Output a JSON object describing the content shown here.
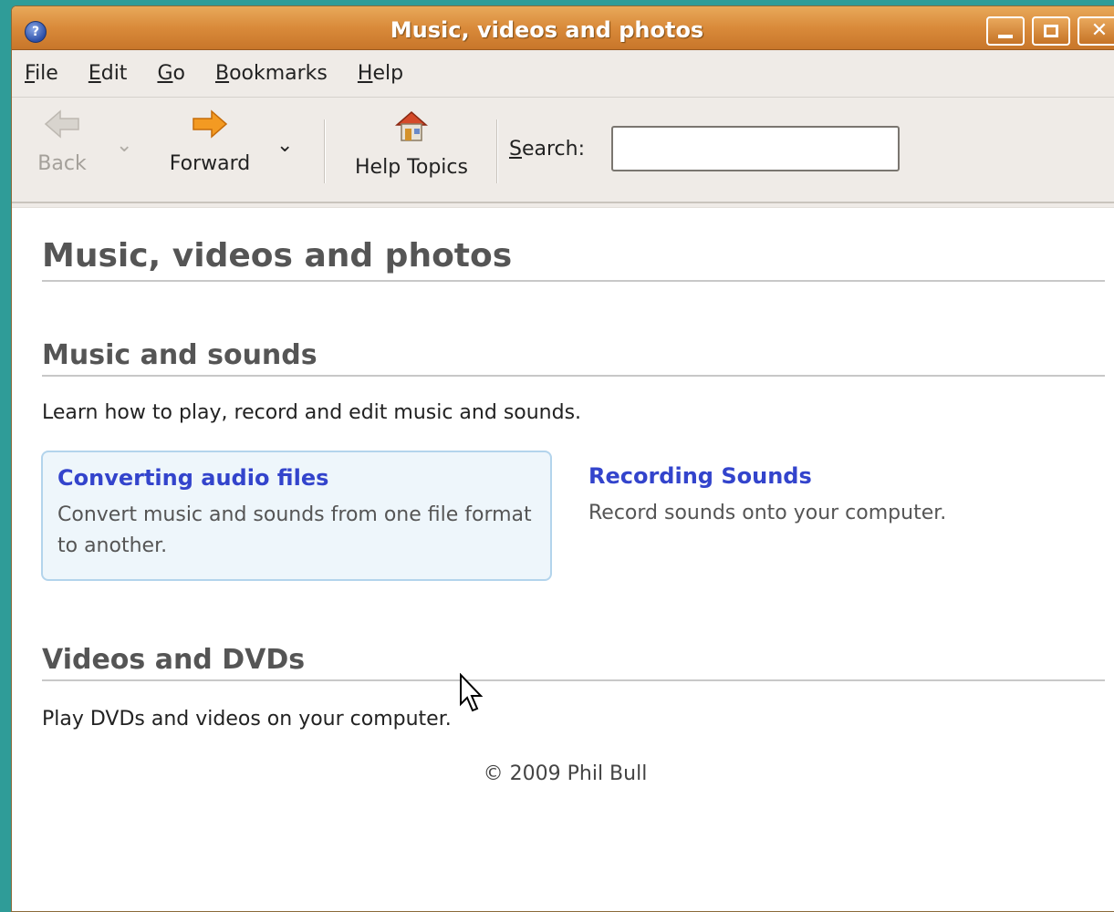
{
  "window": {
    "title": "Music, videos and photos",
    "icon": "help-icon",
    "buttons": [
      "minimize-icon",
      "maximize-icon",
      "close-icon"
    ]
  },
  "menubar": {
    "items": [
      {
        "mnemonic": "F",
        "rest": "ile"
      },
      {
        "mnemonic": "E",
        "rest": "dit"
      },
      {
        "mnemonic": "G",
        "rest": "o"
      },
      {
        "mnemonic": "B",
        "rest": "ookmarks"
      },
      {
        "mnemonic": "H",
        "rest": "elp"
      }
    ]
  },
  "toolbar": {
    "back_label": "Back",
    "forward_label": "Forward",
    "help_label": "Help Topics",
    "search_mnemonic": "S",
    "search_rest": "earch:",
    "search_value": ""
  },
  "content": {
    "page_title": "Music, videos and photos",
    "sections": [
      {
        "title": "Music and sounds",
        "description": "Learn how to play, record and edit music and sounds.",
        "links": [
          {
            "title": "Converting audio files",
            "body": "Convert music and sounds from one file format to another."
          },
          {
            "title": "Recording Sounds",
            "body": "Record sounds onto your computer."
          }
        ]
      },
      {
        "title": "Videos and DVDs",
        "description": "Play DVDs and videos on your computer."
      }
    ],
    "copyright": "© 2009 Phil Bull"
  },
  "colors": {
    "desktop": "#2f9c98",
    "titlebar": "#d98a3a",
    "link": "#3344cc",
    "hover_card_bg": "#eef6fb"
  }
}
